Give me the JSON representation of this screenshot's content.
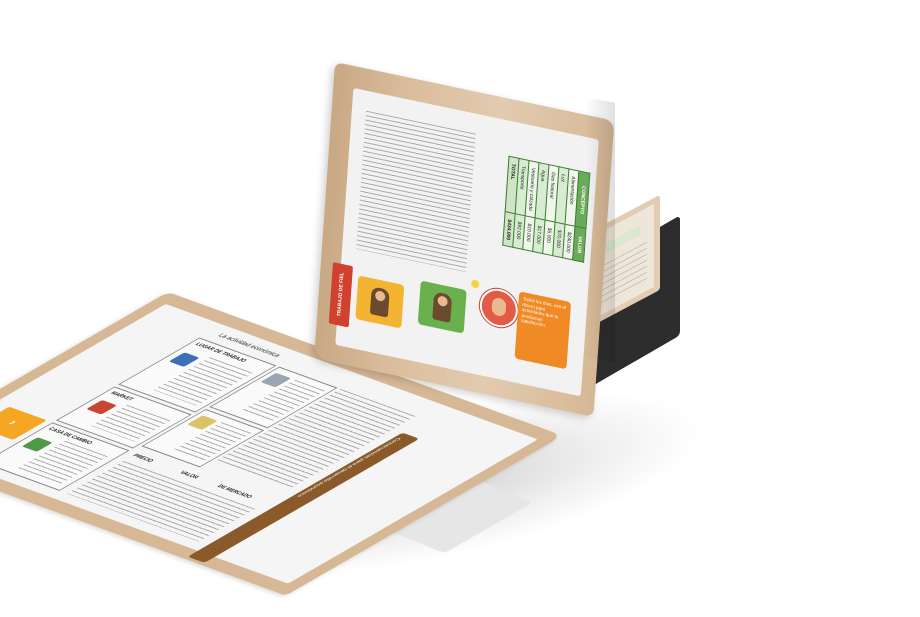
{
  "lower_page": {
    "badge": "3",
    "section_heading": "La actividad económica",
    "boxes": [
      {
        "label": "LUGAR DE TRABAJO",
        "icon": "building-icon"
      },
      {
        "label": "MARKET",
        "icon": "bank-icon"
      },
      {
        "label": "CASA DE CAMBIO",
        "icon": "money-exchange-icon"
      }
    ],
    "labels": [
      "PRECIO",
      "VALOR",
      "DE MERCADO"
    ],
    "note_bar": "Consecuencias para el desarrollo económico"
  },
  "upper_page": {
    "tag": "TRABAJO DE FIEL",
    "orange_note": "Todos los días, usa el dinero para actividades que te produzcan satisfacción.",
    "table": {
      "headers": [
        "CONCEPTO",
        "VALOR"
      ],
      "rows": [
        [
          "Alimentación",
          "$240.000"
        ],
        [
          "Luz",
          "$70.000"
        ],
        [
          "Gas Natural",
          "$5.000"
        ],
        [
          "Agua",
          "$17.000"
        ],
        [
          "Vestuario y calzado",
          "$10.000"
        ],
        [
          "Transporte",
          "$92.000"
        ]
      ],
      "total": [
        "TOTAL",
        "$434.000"
      ]
    }
  },
  "colors": {
    "page_border": "#d7b896",
    "accent_orange": "#f08a24",
    "accent_red": "#d0412f",
    "table_green": "#6aaa5a",
    "back_cover": "#2d2d2d"
  }
}
